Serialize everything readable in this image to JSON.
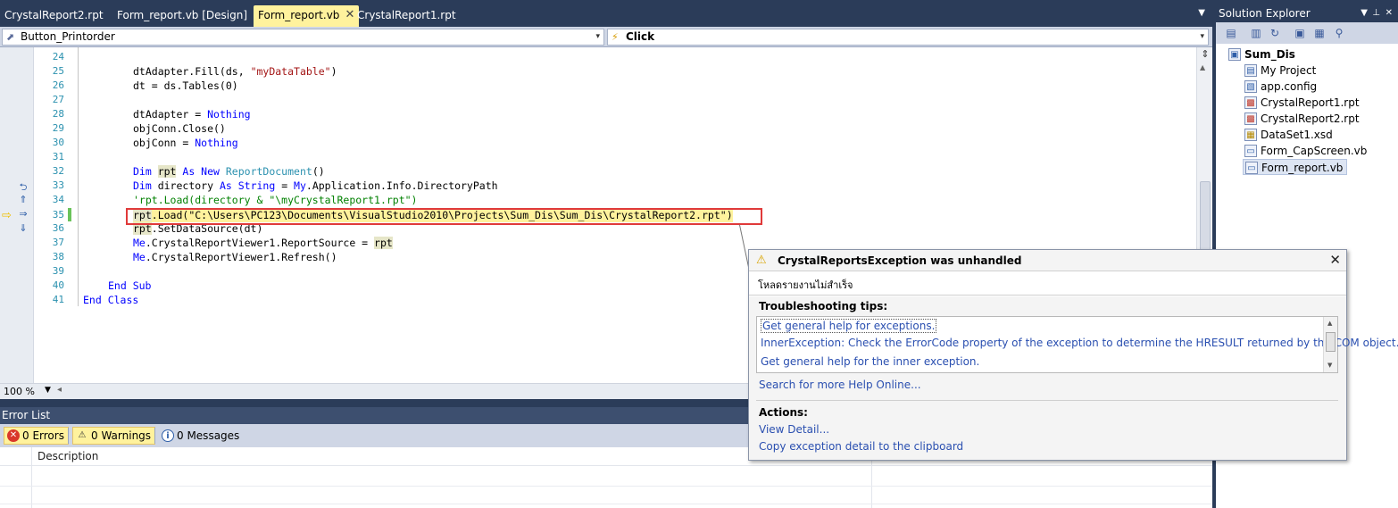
{
  "doc_tabs": [
    {
      "label": "CrystalReport2.rpt"
    },
    {
      "label": "Form_report.vb [Design]"
    },
    {
      "label": "Form_report.vb",
      "active": true
    },
    {
      "label": "CrystalReport1.rpt"
    }
  ],
  "navbar": {
    "object": "Button_Printorder",
    "method": "Click"
  },
  "code": {
    "line_numbers": [
      "24",
      "25",
      "26",
      "27",
      "28",
      "29",
      "30",
      "31",
      "32",
      "33",
      "34",
      "35",
      "36",
      "37",
      "38",
      "39",
      "40",
      "41"
    ],
    "lines": {
      "l25a": "dtAdapter.Fill(ds, ",
      "l25b": "\"myDataTable\"",
      "l25c": ")",
      "l26": "dt = ds.Tables(0)",
      "l28a": "dtAdapter = ",
      "l28b": "Nothing",
      "l29": "objConn.Close()",
      "l30a": "objConn = ",
      "l30b": "Nothing",
      "l32a": "Dim ",
      "l32b": "rpt",
      "l32c": " As New ",
      "l32d": "ReportDocument",
      "l32e": "()",
      "l33a": "Dim ",
      "l33b": "directory ",
      "l33c": "As String",
      "l33d": " = ",
      "l33e": "My",
      "l33f": ".Application.Info.DirectoryPath",
      "l34": "'rpt.Load(directory & \"\\myCrystalReport1.rpt\")",
      "l35a": "rpt",
      "l35b": ".Load(",
      "l35c": "\"C:\\Users\\PC123\\Documents\\VisualStudio2010\\Projects\\Sum_Dis\\Sum_Dis\\CrystalReport2.rpt\"",
      "l35d": ")",
      "l36a": "rpt",
      "l36b": ".SetDataSource(dt)",
      "l37a": "Me",
      "l37b": ".CrystalReportViewer1.ReportSource = ",
      "l37c": "rpt",
      "l38a": "Me",
      "l38b": ".CrystalReportViewer1.Refresh()",
      "l40": "End Sub",
      "l41": "End Class"
    },
    "current_line": 35
  },
  "zoom": {
    "value": "100 %"
  },
  "error_list": {
    "title": "Error List",
    "errors_label": "0 Errors",
    "warnings_label": "0 Warnings",
    "messages_label": "0 Messages",
    "columns": {
      "description": "Description"
    }
  },
  "solution_explorer": {
    "title": "Solution Explorer",
    "root": "Sum_Dis",
    "items": [
      {
        "label": "My Project",
        "icon": "folder-icon"
      },
      {
        "label": "app.config",
        "icon": "config-icon"
      },
      {
        "label": "CrystalReport1.rpt",
        "icon": "report-icon"
      },
      {
        "label": "CrystalReport2.rpt",
        "icon": "report-icon"
      },
      {
        "label": "DataSet1.xsd",
        "icon": "dataset-icon"
      },
      {
        "label": "Form_CapScreen.vb",
        "icon": "form-icon"
      },
      {
        "label": "Form_report.vb",
        "icon": "form-icon",
        "selected": true
      }
    ]
  },
  "exception": {
    "title": "CrystalReportsException was unhandled",
    "message": "โหลดรายงานไม่สำเร็จ",
    "tips_heading": "Troubleshooting tips:",
    "tips": [
      "Get general help for exceptions.",
      "InnerException: Check the ErrorCode property of the exception to determine the HRESULT returned by the COM object.",
      "Get general help for the inner exception."
    ],
    "search_link": "Search for more Help Online...",
    "actions_heading": "Actions:",
    "actions": [
      "View Detail...",
      "Copy exception detail to the clipboard"
    ]
  },
  "colors": {
    "chrome": "#2b3c59",
    "active_tab": "#fff29d",
    "keyword": "#0000ff",
    "string": "#a31515",
    "comment": "#008000",
    "type": "#2b91af",
    "error_box": "#e03a3a"
  }
}
